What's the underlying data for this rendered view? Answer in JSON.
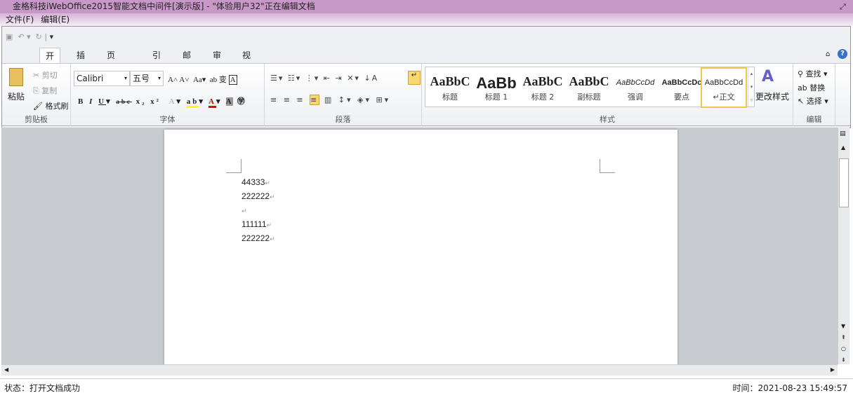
{
  "window": {
    "title": "金格科技iWebOffice2015智能文档中间件[演示版] - \"体验用户32\"正在编辑文档"
  },
  "menu": [
    "文件(F)",
    "编辑(E)"
  ],
  "tabs": [
    "开始",
    "插入",
    "页面布局",
    "引用",
    "邮件",
    "审阅",
    "视图"
  ],
  "clipboard": {
    "paste": "粘贴",
    "cut": "剪切",
    "copy": "复制",
    "format_painter": "格式刷",
    "label": "剪贴板"
  },
  "font": {
    "name": "Calibri",
    "size": "五号",
    "label": "字体"
  },
  "paragraph": {
    "label": "段落"
  },
  "styles": {
    "items": [
      "标题",
      "标题 1",
      "标题 2",
      "副标题",
      "强调",
      "要点",
      "正文"
    ],
    "previews": [
      "AaBbC",
      "AaBb",
      "AaBbC",
      "AaBbC",
      "AaBbCcDd",
      "AaBbCcDc",
      "AaBbCcDd"
    ],
    "change": "更改样式",
    "label": "样式",
    "selected": "正文"
  },
  "editing": {
    "find": "查找",
    "replace": "替换",
    "select": "选择",
    "label": "编辑"
  },
  "document": {
    "lines": [
      "44333",
      "222222",
      "",
      "111111",
      "222222"
    ]
  },
  "status": {
    "left": "状态：打开文档成功",
    "right": "时间：2021-08-23 15:49:57"
  },
  "colors": {
    "titlebar": "#c898c8",
    "highlight": "#ffff00",
    "font_color": "#e00000",
    "selected_style": "#f0c850"
  }
}
